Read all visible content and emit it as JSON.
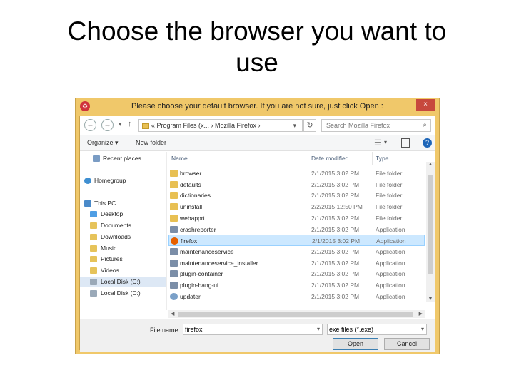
{
  "slide": {
    "title_line1": "Choose the browser you want to",
    "title_line2": "use"
  },
  "dialog": {
    "title": "Please choose your default browser. If you are not sure, just click Open :",
    "close_glyph": "×",
    "app_icon_glyph": "⚙",
    "nav": {
      "back": "←",
      "forward": "→",
      "dropdown": "▾",
      "up": "↑",
      "breadcrumb": "« Program Files (x... › Mozilla Firefox ›",
      "refresh": "↻",
      "search_placeholder": "Search Mozilla Firefox",
      "search_glyph": "⌕"
    },
    "toolbar": {
      "organize": "Organize ▾",
      "new_folder": "New folder",
      "view_glyph": "☰",
      "view_dd": "▾",
      "help_glyph": "?"
    },
    "nav_pane": [
      {
        "label": "Recent places",
        "icon": "recent-places-icon",
        "color": "#7a9cc4"
      },
      {
        "label": "Homegroup",
        "icon": "homegroup-icon",
        "color": "#3f8fd1"
      },
      {
        "label": "This PC",
        "icon": "this-pc-icon",
        "color": "#4a8ac9"
      },
      {
        "label": "Desktop",
        "icon": "desktop-icon",
        "color": "#4f9ee4"
      },
      {
        "label": "Documents",
        "icon": "documents-icon",
        "color": "#e6c35a"
      },
      {
        "label": "Downloads",
        "icon": "downloads-icon",
        "color": "#e6c35a"
      },
      {
        "label": "Music",
        "icon": "music-icon",
        "color": "#e6c35a"
      },
      {
        "label": "Pictures",
        "icon": "pictures-icon",
        "color": "#e6c35a"
      },
      {
        "label": "Videos",
        "icon": "videos-icon",
        "color": "#e6c35a"
      },
      {
        "label": "Local Disk (C:)",
        "icon": "local-disk-icon",
        "color": "#9aa9b8"
      },
      {
        "label": "Local Disk (D:)",
        "icon": "local-disk-icon",
        "color": "#9aa9b8"
      }
    ],
    "columns": {
      "name": "Name",
      "date": "Date modified",
      "type": "Type"
    },
    "files": [
      {
        "name": "browser",
        "date": "2/1/2015 3:02 PM",
        "type": "File folder",
        "kind": "folder",
        "selected": false
      },
      {
        "name": "defaults",
        "date": "2/1/2015 3:02 PM",
        "type": "File folder",
        "kind": "folder",
        "selected": false
      },
      {
        "name": "dictionaries",
        "date": "2/1/2015 3:02 PM",
        "type": "File folder",
        "kind": "folder",
        "selected": false
      },
      {
        "name": "uninstall",
        "date": "2/2/2015 12:50 PM",
        "type": "File folder",
        "kind": "folder",
        "selected": false
      },
      {
        "name": "webapprt",
        "date": "2/1/2015 3:02 PM",
        "type": "File folder",
        "kind": "folder",
        "selected": false
      },
      {
        "name": "crashreporter",
        "date": "2/1/2015 3:02 PM",
        "type": "Application",
        "kind": "app",
        "selected": false
      },
      {
        "name": "firefox",
        "date": "2/1/2015 3:02 PM",
        "type": "Application",
        "kind": "firefox",
        "selected": true
      },
      {
        "name": "maintenanceservice",
        "date": "2/1/2015 3:02 PM",
        "type": "Application",
        "kind": "app",
        "selected": false
      },
      {
        "name": "maintenanceservice_installer",
        "date": "2/1/2015 3:02 PM",
        "type": "Application",
        "kind": "app",
        "selected": false
      },
      {
        "name": "plugin-container",
        "date": "2/1/2015 3:02 PM",
        "type": "Application",
        "kind": "app",
        "selected": false
      },
      {
        "name": "plugin-hang-ui",
        "date": "2/1/2015 3:02 PM",
        "type": "Application",
        "kind": "app",
        "selected": false
      },
      {
        "name": "updater",
        "date": "2/1/2015 3:02 PM",
        "type": "Application",
        "kind": "updater",
        "selected": false
      }
    ],
    "footer": {
      "file_name_label": "File name:",
      "file_name_value": "firefox",
      "file_type": "exe files (*.exe)",
      "dd_glyph": "▾",
      "open_label": "Open",
      "cancel_label": "Cancel"
    },
    "colors": {
      "folder": "#e8c053",
      "app": "#7b8ea8",
      "firefox": "#e66000",
      "updater": "#7aa0c8",
      "selection": "#cce8ff"
    }
  }
}
